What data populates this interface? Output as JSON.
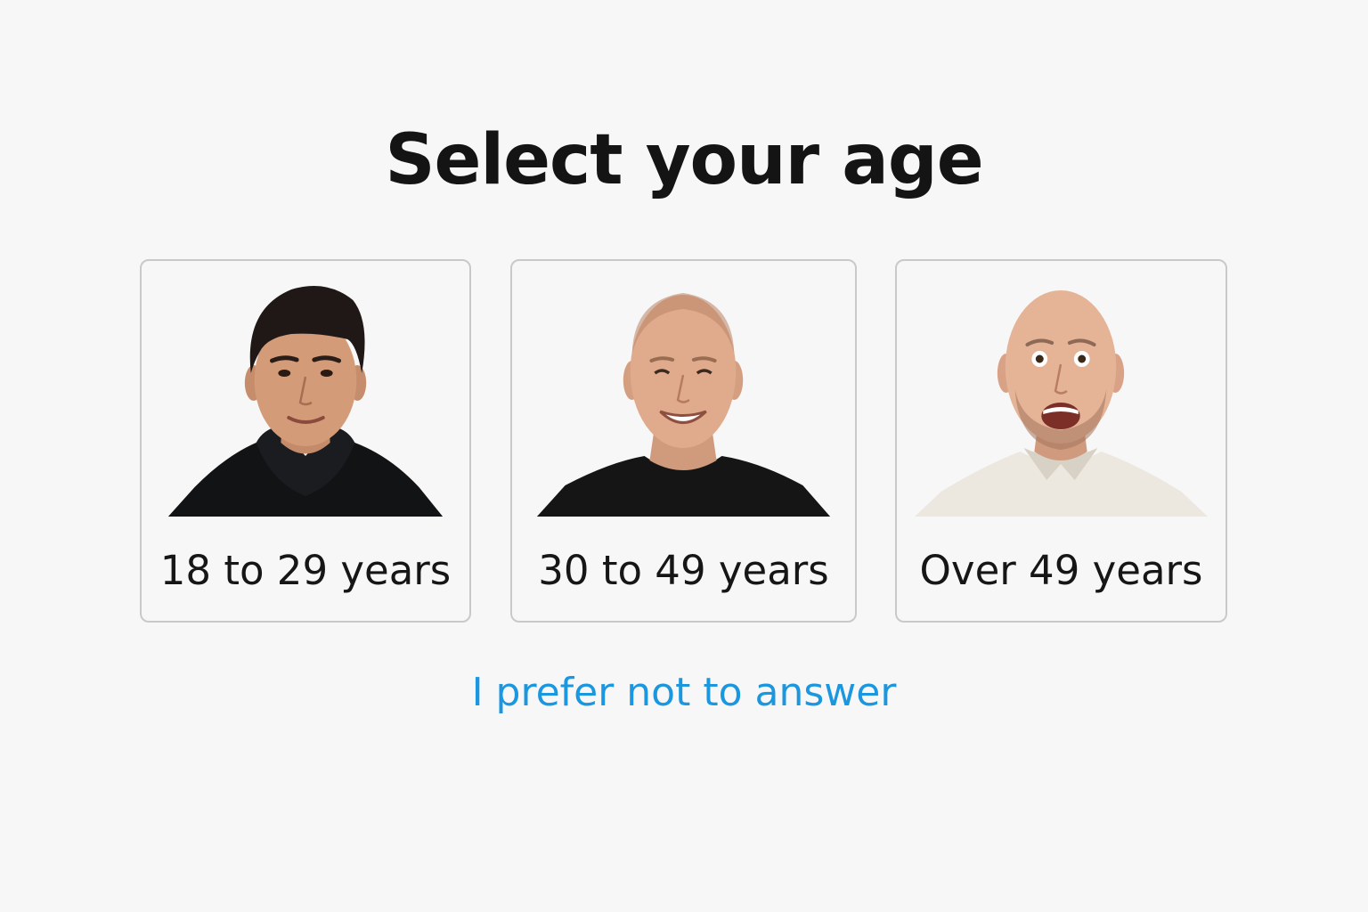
{
  "page": {
    "title": "Select your age"
  },
  "options": [
    {
      "label": "18 to 29 years",
      "portrait": "young-man-portrait"
    },
    {
      "label": "30 to 49 years",
      "portrait": "middle-aged-man-portrait"
    },
    {
      "label": "Over 49 years",
      "portrait": "older-man-portrait"
    }
  ],
  "decline": {
    "label": "I prefer not to answer"
  },
  "colors": {
    "background": "#f7f7f7",
    "card_border": "#c9c9c9",
    "link": "#1b97e0",
    "text": "#141414"
  }
}
